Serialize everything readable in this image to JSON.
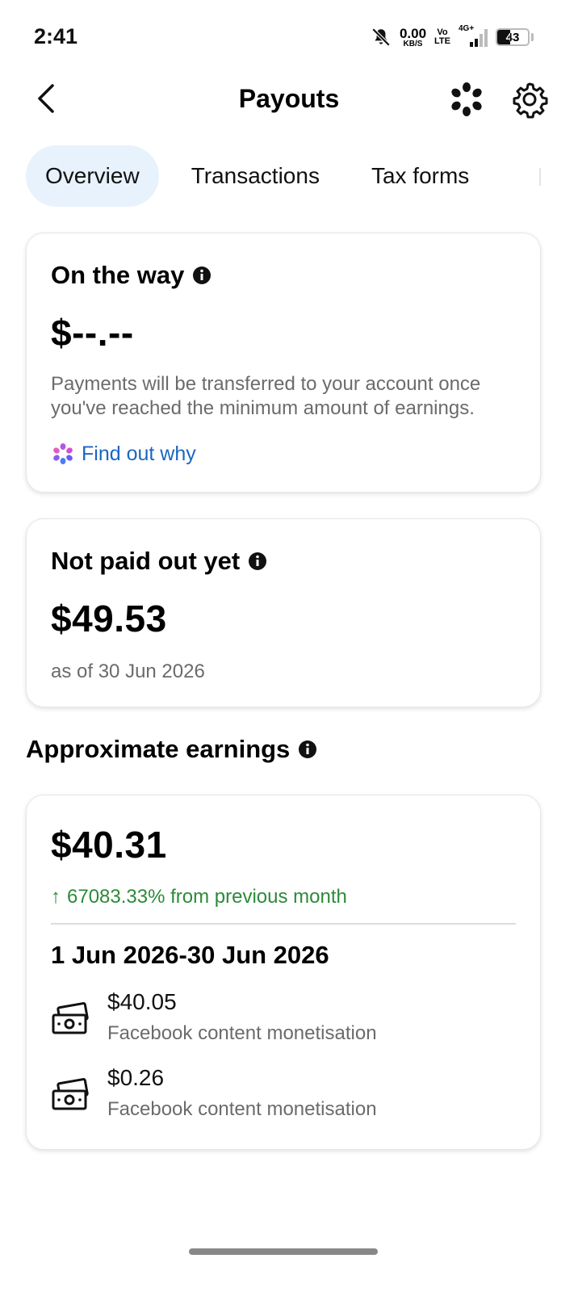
{
  "status_bar": {
    "time": "2:41",
    "net_speed_value": "0.00",
    "net_speed_unit": "KB/S",
    "volte_top": "Vo",
    "volte_bottom": "LTE",
    "network_label": "4G+",
    "battery_level": "43",
    "icons": [
      "bell-muted-icon",
      "signal-icon",
      "battery-icon"
    ]
  },
  "header": {
    "title": "Payouts",
    "back_icon": "chevron-left-icon",
    "meta_icon": "meta-ai-icon",
    "settings_icon": "gear-icon"
  },
  "tabs": [
    {
      "label": "Overview",
      "active": true
    },
    {
      "label": "Transactions",
      "active": false
    },
    {
      "label": "Tax forms",
      "active": false
    }
  ],
  "on_the_way": {
    "title": "On the way",
    "amount": "$--.--",
    "description": "Payments will be transferred to your account once you've reached the minimum amount of earnings.",
    "link_label": "Find out why"
  },
  "not_paid": {
    "title": "Not paid out yet",
    "amount": "$49.53",
    "as_of": "as of 30 Jun 2026"
  },
  "approximate": {
    "section_title": "Approximate earnings",
    "amount": "$40.31",
    "change_arrow": "↑",
    "change_text": "67083.33% from previous month",
    "period": "1 Jun 2026-30 Jun 2026",
    "items": [
      {
        "value": "$40.05",
        "source": "Facebook content monetisation"
      },
      {
        "value": "$0.26",
        "source": "Facebook content monetisation"
      }
    ]
  },
  "colors": {
    "accent_link": "#1a66c2",
    "positive_green": "#2c8a3a",
    "active_tab_bg": "#e8f2fc",
    "muted_text": "#6b6b6b"
  }
}
